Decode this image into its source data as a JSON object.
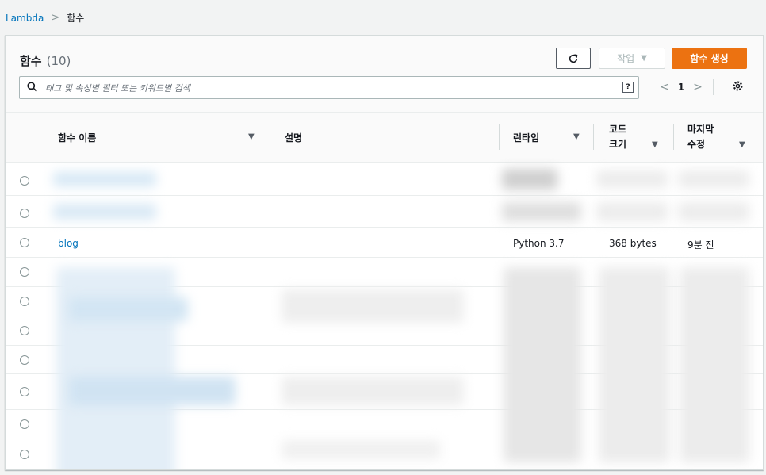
{
  "breadcrumb": {
    "root": "Lambda",
    "separator": ">",
    "current": "함수"
  },
  "panel": {
    "title": "함수",
    "count": "(10)",
    "refresh_icon": "refresh-icon",
    "actions_label": "작업",
    "actions_caret": "▼",
    "create_label": "함수 생성"
  },
  "search": {
    "placeholder": "태그 및 속성별 필터 또는 키워드별 검색",
    "help": "?"
  },
  "pagination": {
    "prev": "<",
    "page": "1",
    "next": ">"
  },
  "table": {
    "columns": {
      "name": "함수 이름",
      "description": "설명",
      "runtime": "런타임",
      "code_size_1": "코드",
      "code_size_2": "크기",
      "modified_1": "마지막",
      "modified_2": "수정"
    },
    "sort_glyph": "▼",
    "visible_row": {
      "name": "blog",
      "runtime": "Python 3.7",
      "code_size": "368 bytes",
      "modified": "9분 전"
    }
  },
  "colors": {
    "link": "#0073bb",
    "primary": "#ec7211",
    "header_bg": "#fafafa"
  }
}
